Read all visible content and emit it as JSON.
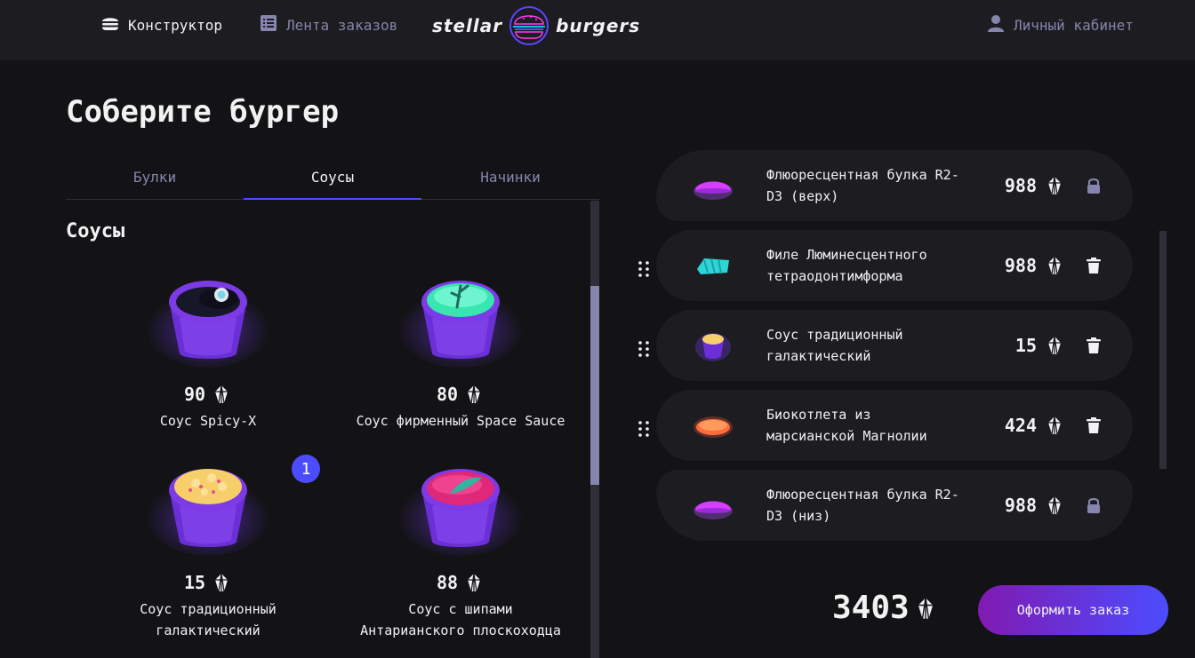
{
  "header": {
    "nav_constructor": "Конструктор",
    "nav_feed": "Лента заказов",
    "logo_left": "stellar",
    "logo_right": "burgers",
    "nav_profile": "Личный кабинет"
  },
  "page_title": "Соберите бургер",
  "tabs": [
    {
      "label": "Булки"
    },
    {
      "label": "Соусы"
    },
    {
      "label": "Начинки"
    }
  ],
  "section_title": "Соусы",
  "ingredients": [
    {
      "price": "90",
      "name": "Соус Spicy-X",
      "icon": "sauce-spicy-icon"
    },
    {
      "price": "80",
      "name": "Соус фирменный Space Sauce",
      "icon": "sauce-space-icon"
    },
    {
      "price": "15",
      "name_line1": "Соус традиционный",
      "name_line2": "галактический",
      "count": "1",
      "icon": "sauce-traditional-icon"
    },
    {
      "price": "88",
      "name_line1": "Соус с шипами",
      "name_line2": "Антарианского плоскоходца",
      "icon": "sauce-spikes-icon"
    }
  ],
  "constructor": {
    "bun_top": {
      "name_line1": "Флюоресцентная булка R2-",
      "name_line2": "D3 (верх)",
      "price": "988"
    },
    "fillings": [
      {
        "name_line1": "Филе Люминесцентного",
        "name_line2": "тетраодонтимформа",
        "price": "988"
      },
      {
        "name_line1": "Соус традиционный",
        "name_line2": "галактический",
        "price": "15"
      },
      {
        "name_line1": "Биокотлета из",
        "name_line2": "марсианской Магнолии",
        "price": "424"
      }
    ],
    "bun_bottom": {
      "name_line1": "Флюоресцентная булка R2-",
      "name_line2": "D3 (низ)",
      "price": "988"
    }
  },
  "total": "3403",
  "order_button": "Оформить заказ",
  "colors": {
    "accent": "#4c4cff",
    "background": "#131316",
    "panel": "#1c1c21",
    "inactive": "#8585ad"
  }
}
